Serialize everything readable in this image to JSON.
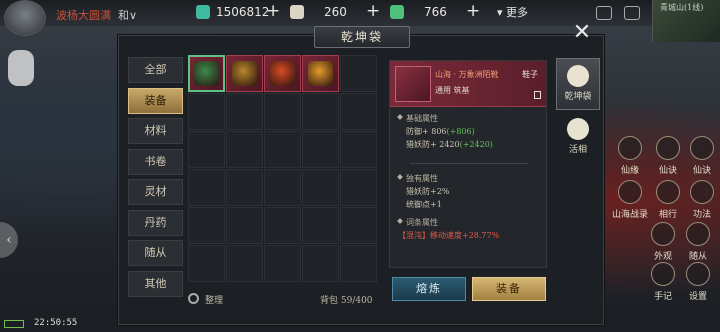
{
  "hud": {
    "player_name": "波杨大圆满",
    "player_level": "和∨",
    "currencies": [
      {
        "icon": "spirit-stone-icon",
        "value": "1506812",
        "color": "#3fb9a0"
      },
      {
        "icon": "scroll-icon",
        "value": "260",
        "color": "#d9d4c4"
      },
      {
        "icon": "jade-icon",
        "value": "766",
        "color": "#4fc07a"
      }
    ],
    "more_label": "更多",
    "minimap_label": "青城山(1线)",
    "time": "22:50:55"
  },
  "panel": {
    "title": "乾坤袋",
    "close_glyph": "✕"
  },
  "tabs": [
    {
      "label": "全部",
      "active": false
    },
    {
      "label": "装备",
      "active": true
    },
    {
      "label": "材料",
      "active": false
    },
    {
      "label": "书卷",
      "active": false
    },
    {
      "label": "灵材",
      "active": false
    },
    {
      "label": "丹药",
      "active": false
    },
    {
      "label": "随从",
      "active": false
    },
    {
      "label": "其他",
      "active": false
    }
  ],
  "grid": {
    "items": [
      {
        "name": "boots-item-icon",
        "color": "#3c8a4a",
        "selected": true
      },
      {
        "name": "armor-item-icon",
        "color": "#b8862a",
        "selected": false
      },
      {
        "name": "crest-item-icon",
        "color": "#d84a22",
        "selected": false
      },
      {
        "name": "orb-item-icon",
        "color": "#e39a2a",
        "selected": false
      }
    ],
    "sort_label": "整理",
    "bag_count": "背包 59/400"
  },
  "detail": {
    "item_name": "山海 · 万象洲陌靴",
    "item_type": "鞋子",
    "item_sub": "通用 筑基",
    "basic_title": "基础属性",
    "basic_attrs": [
      {
        "label": "防御+ 806",
        "bonus": "(+806)"
      },
      {
        "label": "猎妖防+ 2420",
        "bonus": "(+2420)"
      }
    ],
    "unique_title": "独有属性",
    "unique_attrs": [
      "猎妖防+2%",
      "统御点+1"
    ],
    "affix_title": "词条属性",
    "affix_attrs": [
      "【混沌】移动速度+28.77%"
    ]
  },
  "buttons": {
    "smelt": "熔炼",
    "equip": "装备"
  },
  "side_tabs": [
    {
      "label": "乾坤袋",
      "active": true
    },
    {
      "label": "活相",
      "active": false
    }
  ],
  "right_hud": [
    "仙缘",
    "仙诀",
    "山海战录",
    "相行",
    "功法",
    "外观",
    "随从",
    "手记",
    "设置"
  ]
}
